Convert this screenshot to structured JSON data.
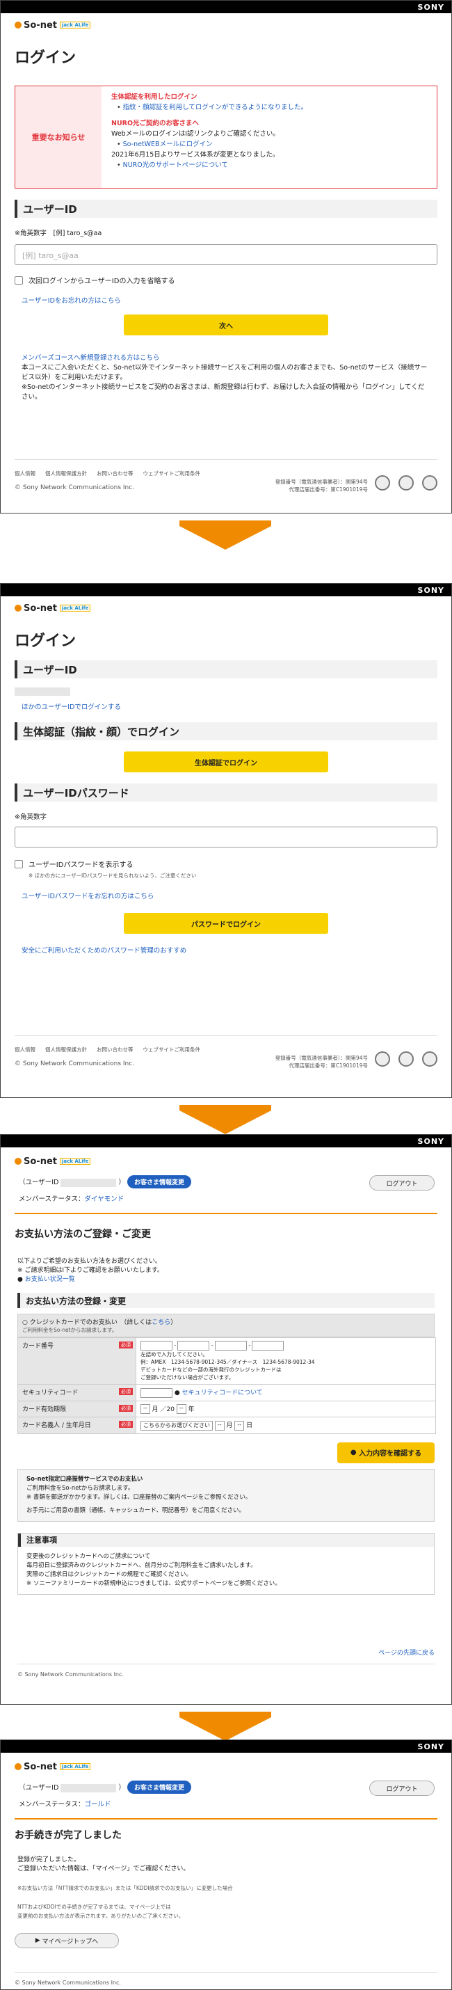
{
  "brand": "SONY",
  "logo": {
    "name": "So-net",
    "sub": "jack ALife"
  },
  "screen1": {
    "title": "ログイン",
    "notice_label": "重要なお知らせ",
    "notice_lines": [
      {
        "text": "生体認証を利用したログイン",
        "style": "red"
      },
      {
        "text": "指紋・顔認証を利用してログインができるようになりました。",
        "style": "link"
      },
      {
        "text": "NURO光ご契約のお客さまへ",
        "style": "red"
      },
      {
        "text": "WebメールのログインはI認リンクよりご確認ください。",
        "style": "plain"
      },
      {
        "text": "So-netWEBメールにログイン",
        "style": "link"
      },
      {
        "text": "2021年6月15日よりサービス体系が変更となりました。",
        "style": "plain"
      },
      {
        "text": "NURO光のサポートページについて",
        "style": "link"
      }
    ],
    "section_userid": "ユーザーID",
    "hint": "※角英数字",
    "hint_example": "[例] taro_s@aa",
    "input_placeholder": "[例] taro_s@aa",
    "remember": "次回ログインからユーザーIDの入力を省略する",
    "forgot": "ユーザーIDをお忘れの方はこちら",
    "next": "次へ",
    "register": "メンバーズコースへ新規登録される方はこちら",
    "note1": "本コースにご入会いただくと、So-net以外でインターネット接続サービスをご利用の個人のお客さまでも、So-netのサービス（接続サービス以外）をご利用いただけます。",
    "note2": "※So-netのインターネット接続サービスをご契約のお客さまは、新規登録は行わず、お届けした入会証の情報から「ログイン」してください。"
  },
  "footer": {
    "links": [
      "個人情報",
      "個人情報保護方針",
      "お問い合わせ等",
      "ウェブサイトご利用条件"
    ],
    "copyright": "© Sony Network Communications Inc.",
    "reg1": "登録番号（電気通信事業者）：関第94号",
    "reg2": "代理店届出番号：第C1901019号"
  },
  "screen2": {
    "title": "ログイン",
    "section_userid": "ユーザーID",
    "other_id": "ほかのユーザーIDでログインする",
    "section_bio": "生体認証（指紋・顔）でログイン",
    "bio_btn": "生体認証でログイン",
    "section_pw": "ユーザーIDパスワード",
    "hint": "※角英数字",
    "show_pw": "ユーザーIDパスワードを表示する",
    "show_pw_note": "※ ほかの方にユーザーIDパスワードを見られないよう、ご注意ください",
    "forgot_pw": "ユーザーIDパスワードをお忘れの方はこちら",
    "login_btn": "パスワードでログイン",
    "safety": "安全にご利用いただくためのパスワード管理のおすすめ"
  },
  "screen3": {
    "userid_prefix": "（ユーザーID",
    "userid_suffix": "）",
    "change_btn": "お客さま情報変更",
    "logout": "ログアウト",
    "member_status_label": "メンバーステータス：",
    "member_status": "ダイヤモンド",
    "title": "お支払い方法のご登録・ご変更",
    "intro1": "以下よりご希望のお支払い方法をお選びください。",
    "intro2": "※ ご請求明細はI下よりご確認をお願いいたします。",
    "intro_link": "お支払い状況一覧",
    "section": "お支払い方法の登録・変更",
    "credit_radio": "クレジットカードでのお支払い",
    "credit_detail": "（詳しくは",
    "credit_detail_link": "こちら",
    "credit_detail_end": "）",
    "credit_sub": "ご利用料金をSo-netからお請求します。",
    "row_card": "カード番号",
    "row_card_note1": "左詰めで入力してください。",
    "row_card_note2": "例：AMEX　1234-5678-9012-345／ダイナース　1234-5678-9012-34",
    "row_card_note3": "デビットカードなどの一部の海外発行のクレジットカードは",
    "row_card_note4": "ご登録いただけない場合がございます。",
    "row_sec": "セキュリティコード",
    "row_sec_link": "セキュリティコードについて",
    "row_exp": "カード有効期限",
    "exp_month": "--",
    "exp_mid": "月 ／20",
    "exp_year": "--",
    "exp_end": "年",
    "row_name": "カード名義人 / 生年月日",
    "name_select": "こちらからお選びください",
    "dob_m": "--",
    "dob_m_end": "月",
    "dob_d": "--",
    "dob_d_end": "日",
    "required": "必須",
    "confirm_btn": "入力内容を確認する",
    "bank_title": "So-net指定口座振替サービスでのお支払い",
    "bank_sub": "ご利用料金をSo-netからお請求します。",
    "bank_note1": "※ 書類を郵送がかかります。詳しくは、口座振替のご案内ページをご参照ください。",
    "bank_note2": "お手元にご用意の書類（通帳、キャッシュカード、明記番号）をご用意ください。",
    "attention_title": "注意事項",
    "att1": "変更後のクレジットカードへのご請求について",
    "att2": "毎月初日に登録済みのクレジットカードへ、前月分のご利用料金をご請求いたします。",
    "att3": "実際のご請求日はクレジットカードの規程でご確認ください。",
    "att4": "※ ソニーファミリーカードの新規申込につきましては、公式サポートページをご参照ください。",
    "back_top": "ページの先頭に戻る",
    "copyright": "© Sony Network Communications Inc."
  },
  "screen4": {
    "userid_prefix": "（ユーザーID",
    "userid_suffix": "）",
    "change_btn": "お客さま情報変更",
    "logout": "ログアウト",
    "member_status_label": "メンバーステータス：",
    "member_status": "ゴールド",
    "title": "お手続きが完了しました",
    "done1": "登録が完了しました。",
    "done2": "ご登録いただいた情報は、「マイページ」でご確認ください。",
    "note1": "※お支払い方法「NTT請求でのお支払い」または「KDDI請求でのお支払い」に変更した場合",
    "note2": "NTTおよびKDDIでの手続きが完了するまでは、マイページ上では",
    "note3": "変更前のお支払い方法が表示されます。ありがたいのご了承ください。",
    "mypage_btn": "マイページトップへ",
    "copyright": "© Sony Network Communications Inc."
  },
  "colors": {
    "accent_yellow": "#f7d200",
    "accent_orange": "#f08a00",
    "link_blue": "#1f5fbf",
    "alert_red": "#e2383f"
  }
}
